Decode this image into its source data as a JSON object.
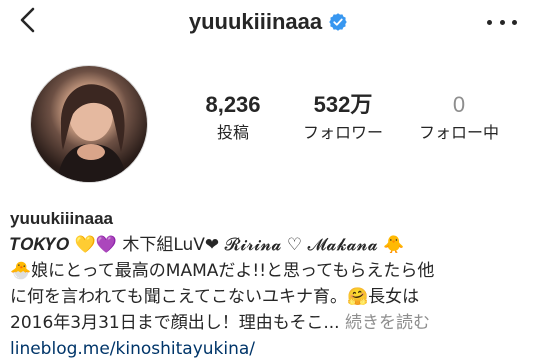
{
  "header": {
    "username": "yuuukiiinaaa",
    "back_icon": "chevron-left-icon",
    "verified_icon": "verified-badge-icon",
    "more_icon": "more-dots-icon",
    "accent_color": "#3897f0"
  },
  "profile": {
    "avatar_icon": "profile-photo"
  },
  "stats": [
    {
      "value": "8,236",
      "label": "投稿"
    },
    {
      "value": "532万",
      "label": "フォロワー"
    },
    {
      "value": "0",
      "label": "フォロー中"
    }
  ],
  "bio": {
    "name": "yuuukiiinaaa",
    "lines": [
      "𝑻𝑶𝑲𝒀𝑶 💛💜 木下組LuV❤︎ 𝓡𝓲𝓻𝓲𝓷𝓪 ♡ 𝓜𝓪𝓴𝓪𝓷𝓪 🐥",
      "🐣娘にとって最高のMAMAだよ!!と思ってもらえたら他",
      "に何を言われても聞こえてこないユキナ育。🤗長女は",
      "2016年3月31日まで顔出し！理由もそこ..."
    ],
    "more_label": "続きを読む",
    "link": "lineblog.me/kinoshitayukina/"
  }
}
